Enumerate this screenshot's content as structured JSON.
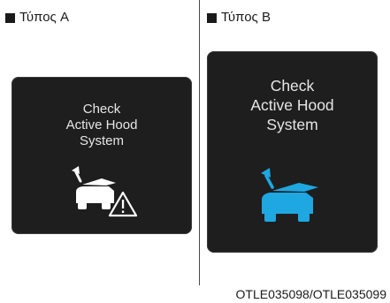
{
  "panel_a": {
    "label": "Τύπος A",
    "message": [
      "Check",
      "Active Hood",
      "System"
    ],
    "icon": "active-hood-warning-icon",
    "icon_color": "#ffffff"
  },
  "panel_b": {
    "label": "Τύπος B",
    "message": [
      "Check",
      "Active Hood",
      "System"
    ],
    "icon": "active-hood-icon",
    "icon_color": "#1ea7e1"
  },
  "footer": {
    "code": "OTLE035098/OTLE035099"
  },
  "colors": {
    "screen_background": "#1e1e1e",
    "screen_text": "#e6e6e6",
    "warning_blue": "#1ea7e1"
  }
}
